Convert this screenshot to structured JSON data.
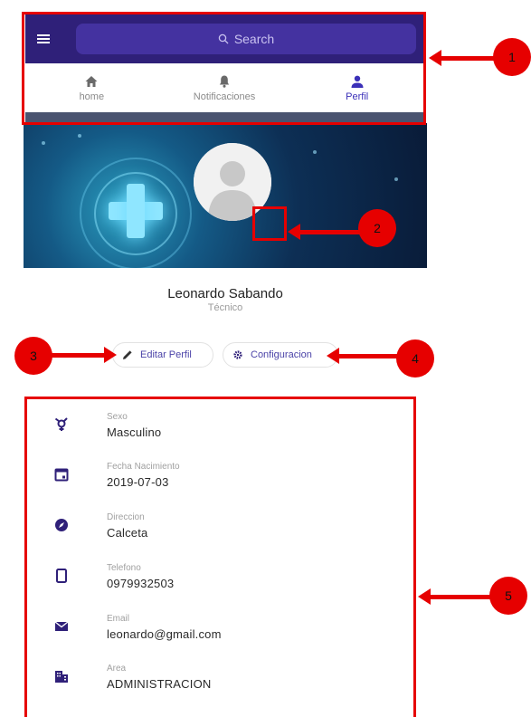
{
  "header": {
    "search_placeholder": "Search",
    "tabs": [
      {
        "label": "home",
        "icon": "home-icon"
      },
      {
        "label": "Notificaciones",
        "icon": "bell-icon"
      },
      {
        "label": "Perfil",
        "icon": "person-icon",
        "active": true
      }
    ]
  },
  "profile": {
    "name": "Leonardo Sabando",
    "role": "Técnico",
    "actions": {
      "edit_label": "Editar Perfil",
      "config_label": "Configuracion"
    }
  },
  "details": [
    {
      "label": "Sexo",
      "value": "Masculino",
      "icon": "gender-icon"
    },
    {
      "label": "Fecha Nacimiento",
      "value": "2019-07-03",
      "icon": "calendar-icon"
    },
    {
      "label": "Direccion",
      "value": "Calceta",
      "icon": "compass-icon"
    },
    {
      "label": "Telefono",
      "value": "0979932503",
      "icon": "phone-icon"
    },
    {
      "label": "Email",
      "value": "leonardo@gmail.com",
      "icon": "mail-icon"
    },
    {
      "label": "Area",
      "value": "ADMINISTRACION",
      "icon": "building-icon"
    }
  ],
  "annotations": [
    "1",
    "2",
    "3",
    "4",
    "5"
  ],
  "colors": {
    "header_bg": "#2f2079",
    "search_bg": "#4432a0",
    "accent": "#3b30b8",
    "annotation_red": "#e60000"
  }
}
